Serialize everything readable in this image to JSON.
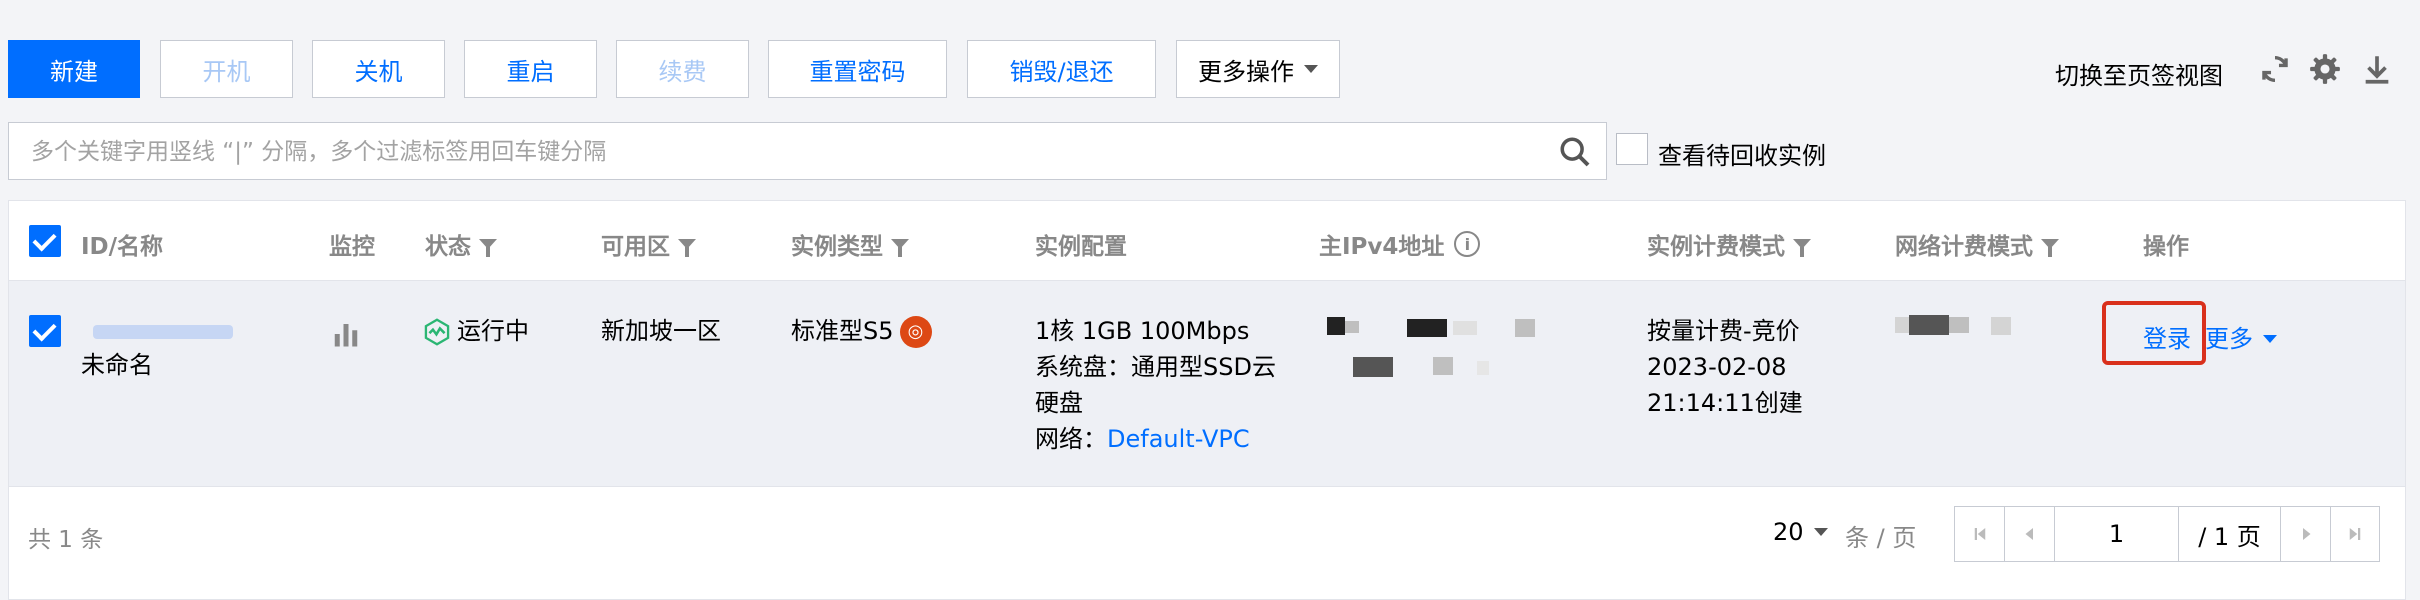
{
  "toolbar": {
    "new_label": "新建",
    "start_label": "开机",
    "shutdown_label": "关机",
    "restart_label": "重启",
    "renew_label": "续费",
    "reset_password_label": "重置密码",
    "destroy_label": "销毁/退还",
    "more_actions_label": "更多操作",
    "switch_view_label": "切换至页签视图",
    "icons": [
      "refresh-icon",
      "settings-icon",
      "download-icon"
    ]
  },
  "search": {
    "placeholder": "多个关键字用竖线 “|” 分隔，多个过滤标签用回车键分隔",
    "recycle_label": "查看待回收实例",
    "recycle_checked": false
  },
  "table": {
    "headers": {
      "id_name": "ID/名称",
      "monitor": "监控",
      "status": "状态",
      "zone": "可用区",
      "instance_type": "实例类型",
      "config": "实例配置",
      "ipv4": "主IPv4地址",
      "billing_mode": "实例计费模式",
      "network_billing": "网络计费模式",
      "actions": "操作"
    },
    "row": {
      "checked": true,
      "name": "未命名",
      "status": "运行中",
      "zone": "新加坡一区",
      "instance_type": "标准型S5",
      "config_line1": "1核 1GB 100Mbps",
      "config_line2": "系统盘：通用型SSD云",
      "config_line3": "硬盘",
      "network_prefix": "网络：",
      "network_link": "Default-VPC",
      "billing_line1": "按量计费-竞价",
      "billing_line2": "2023-02-08",
      "billing_line3": "21:14:11创建",
      "action_login": "登录",
      "action_more": "更多"
    }
  },
  "footer": {
    "total": "共 1 条",
    "page_size": "20",
    "page_size_unit": "条 / 页",
    "current_page": "1",
    "total_pages": "/ 1 页"
  },
  "colors": {
    "accent": "#006eff",
    "running": "#2bb673",
    "highlight_box": "#d9301c"
  }
}
